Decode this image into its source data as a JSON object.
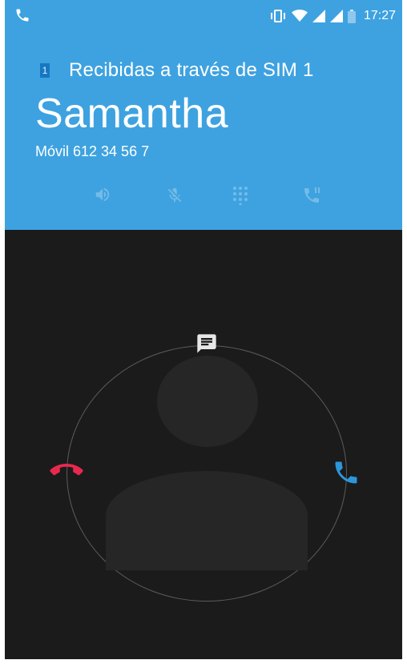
{
  "status_bar": {
    "time": "17:27",
    "icons": [
      "phone-icon",
      "vibrate-icon",
      "wifi-icon",
      "signal-icon",
      "signal-icon",
      "battery-icon"
    ]
  },
  "call": {
    "sim_badge": "1",
    "received_via": "Recibidas a través de SIM 1",
    "caller_name": "Samantha",
    "caller_number": "Móvil 612 34 56 7"
  },
  "controls": [
    "speaker-icon",
    "mute-icon",
    "dialpad-icon",
    "hold-call-icon"
  ],
  "incoming_actions": [
    "message-icon",
    "decline-call-icon",
    "answer-call-icon"
  ],
  "colors": {
    "header": "#3ea2e0",
    "background": "#1b1b1b",
    "decline": "#e8294f",
    "answer": "#2d96d8"
  }
}
